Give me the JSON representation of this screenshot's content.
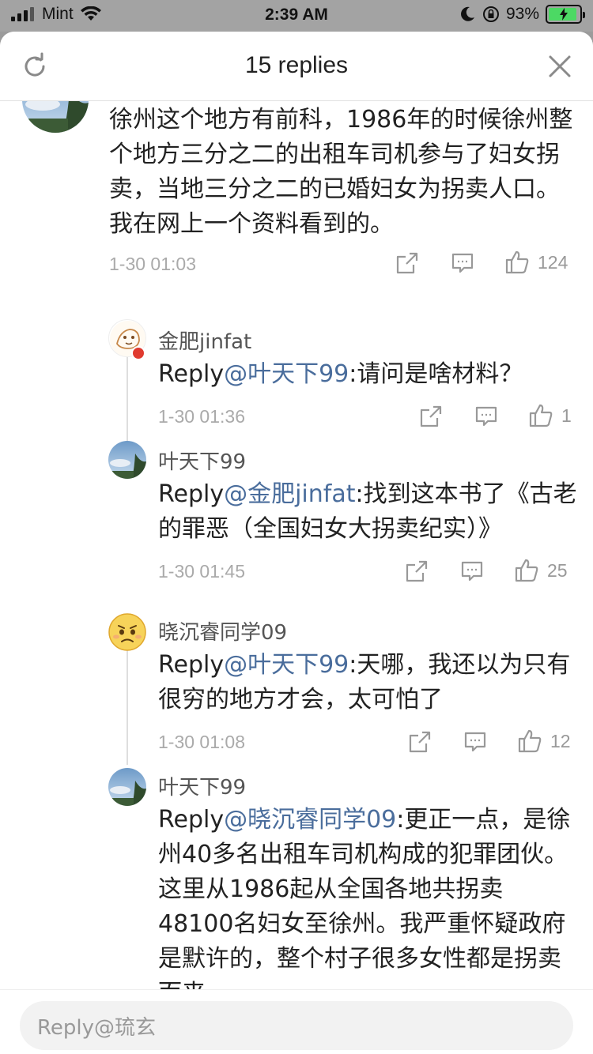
{
  "status_bar": {
    "carrier": "Mint",
    "time": "2:39 AM",
    "battery": "93%"
  },
  "header": {
    "title": "15 replies"
  },
  "main_comment": {
    "text": "徐州这个地方有前科，1986年的时候徐州整个地方三分之二的出租车司机参与了妇女拐卖，当地三分之二的已婚妇女为拐卖人口。我在网上一个资料看到的。",
    "time": "1-30 01:03",
    "likes": "124"
  },
  "replies": [
    {
      "username": "金肥jinfat",
      "prefix": "Reply",
      "mention": "@叶天下99",
      "body": ":请问是啥材料？",
      "time": "1-30 01:36",
      "likes": "1"
    },
    {
      "username": "叶天下99",
      "prefix": "Reply",
      "mention": "@金肥jinfat",
      "body": ":找到这本书了《古老的罪恶（全国妇女大拐卖纪实）》",
      "time": "1-30 01:45",
      "likes": "25"
    },
    {
      "username": "晓沉睿同学09",
      "prefix": "Reply",
      "mention": "@叶天下99",
      "body": ":天哪，我还以为只有很穷的地方才会，太可怕了",
      "time": "1-30 01:08",
      "likes": "12"
    },
    {
      "username": "叶天下99",
      "prefix": "Reply",
      "mention": "@晓沉睿同学09",
      "body": ":更正一点，是徐州40多名出租车司机构成的犯罪团伙。这里从1986起从全国各地共拐卖48100名妇女至徐州。我严重怀疑政府是默许的，整个村子很多女性都是拐卖而来。",
      "time": "",
      "likes": ""
    }
  ],
  "reply_bar": {
    "placeholder": "Reply@琉玄"
  },
  "colors": {
    "mention": "#4a6d9c",
    "meta": "#aaaaaa",
    "battery": "#4cd964"
  },
  "icons": [
    "refresh-icon",
    "close-icon",
    "share-icon",
    "comment-icon",
    "thumbs-up-icon"
  ]
}
